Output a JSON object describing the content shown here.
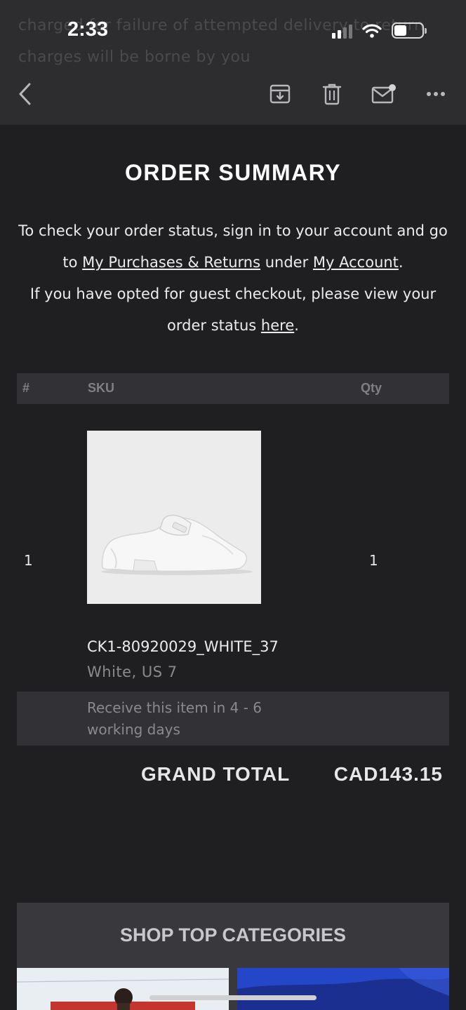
{
  "status_bar": {
    "time": "2:33"
  },
  "email_header": {
    "ghost_text": "charged for failure of attempted delivery to return charges will be borne by you"
  },
  "toolbar": {
    "back_icon": "chevron-left-icon",
    "archive_icon": "archive-icon",
    "trash_icon": "trash-icon",
    "mail_icon": "mail-unread-icon",
    "more_icon": "more-horizontal-icon"
  },
  "order": {
    "title": "ORDER SUMMARY",
    "info_line1": "To check your order status, sign in to your account and go to ",
    "link_purchases": "My Purchases & Returns",
    "info_under": " under ",
    "link_account": "My Account",
    "info_period": ".",
    "info_line2": "If you have opted for guest checkout, please view your order status ",
    "link_here": "here",
    "info_period2": ".",
    "table": {
      "headers": {
        "num": "#",
        "sku": "SKU",
        "qty": "Qty"
      },
      "rows": [
        {
          "num": "1",
          "qty": "1",
          "sku": "CK1-80920029_WHITE_37",
          "variant": "White, US 7",
          "delivery": "Receive this item in 4 - 6 working days"
        }
      ]
    },
    "grand_total_label": "GRAND TOTAL",
    "grand_total_value": "CAD143.15"
  },
  "shop": {
    "title": "SHOP TOP CATEGORIES"
  },
  "colors": {
    "background": "#1f1f22",
    "header": "#2d2d30",
    "table_header": "#323236"
  }
}
